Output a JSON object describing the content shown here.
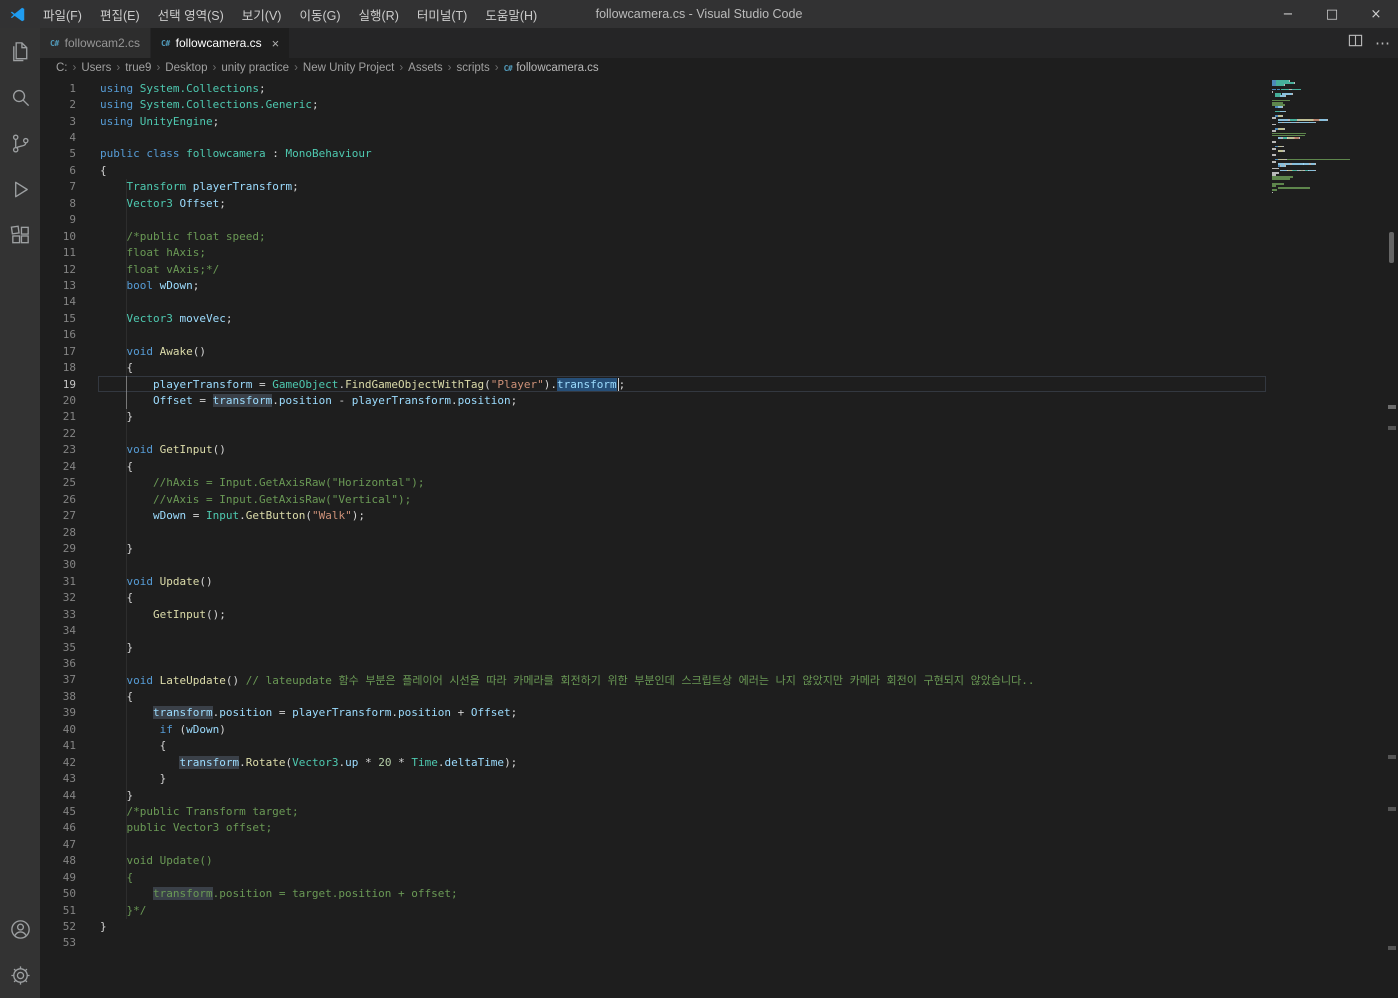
{
  "window": {
    "title": "followcamera.cs - Visual Studio Code",
    "controls": {
      "minimize": "−",
      "maximize": "□",
      "close": "×"
    }
  },
  "menubar": {
    "items": [
      "파일(F)",
      "편집(E)",
      "선택 영역(S)",
      "보기(V)",
      "이동(G)",
      "실행(R)",
      "터미널(T)",
      "도움말(H)"
    ]
  },
  "activity_bar": {
    "top_icons": [
      "explorer",
      "search",
      "source-control",
      "run-debug",
      "extensions"
    ],
    "bottom_icons": [
      "account",
      "settings"
    ]
  },
  "tab_bar": {
    "tabs": [
      {
        "label": "followcam2.cs",
        "icon": "C#",
        "active": false
      },
      {
        "label": "followcamera.cs",
        "icon": "C#",
        "active": true,
        "close": "×"
      }
    ],
    "more_glyph": "⋯"
  },
  "breadcrumb": {
    "separator": "›",
    "segments": [
      "C:",
      "Users",
      "true9",
      "Desktop",
      "unity practice",
      "New Unity Project",
      "Assets",
      "scripts"
    ],
    "file_icon": "C#",
    "file": "followcamera.cs"
  },
  "colors": {
    "accent_blue": "#007acc",
    "titlebar_bg": "#323233",
    "activitybar_bg": "#333333",
    "editor_bg": "#1e1e1e",
    "tab_inactive_bg": "#2d2d2d",
    "tab_active_bg": "#1e1e1e",
    "selection_bg": "#264f78",
    "word_highlight_bg": "#3a4048",
    "csharp_icon": "#519aba",
    "token": {
      "kw": "#569cd6",
      "ty": "#4ec9b0",
      "m": "#dcdcaa",
      "v": "#9cdcfe",
      "st": "#ce9178",
      "cm": "#6a9955",
      "nm": "#b5cea8",
      "pl": "#d4d4d4"
    }
  },
  "editor": {
    "language": "csharp",
    "current_line": 19,
    "lines": [
      {
        "n": 1,
        "t": [
          [
            "kw",
            "using"
          ],
          [
            "pl",
            " "
          ],
          [
            "ty",
            "System.Collections"
          ],
          [
            "pl",
            ";"
          ]
        ]
      },
      {
        "n": 2,
        "t": [
          [
            "kw",
            "using"
          ],
          [
            "pl",
            " "
          ],
          [
            "ty",
            "System.Collections.Generic"
          ],
          [
            "pl",
            ";"
          ]
        ]
      },
      {
        "n": 3,
        "t": [
          [
            "kw",
            "using"
          ],
          [
            "pl",
            " "
          ],
          [
            "ty",
            "UnityEngine"
          ],
          [
            "pl",
            ";"
          ]
        ]
      },
      {
        "n": 4,
        "t": []
      },
      {
        "n": 5,
        "t": [
          [
            "kw",
            "public"
          ],
          [
            "pl",
            " "
          ],
          [
            "kw",
            "class"
          ],
          [
            "pl",
            " "
          ],
          [
            "ty",
            "followcamera"
          ],
          [
            "pl",
            " : "
          ],
          [
            "ty",
            "MonoBehaviour"
          ]
        ]
      },
      {
        "n": 6,
        "t": [
          [
            "pl",
            "{"
          ]
        ]
      },
      {
        "n": 7,
        "t": [
          [
            "pl",
            "    "
          ],
          [
            "ty",
            "Transform"
          ],
          [
            "pl",
            " "
          ],
          [
            "v",
            "playerTransform"
          ],
          [
            "pl",
            ";"
          ]
        ]
      },
      {
        "n": 8,
        "t": [
          [
            "pl",
            "    "
          ],
          [
            "ty",
            "Vector3"
          ],
          [
            "pl",
            " "
          ],
          [
            "v",
            "Offset"
          ],
          [
            "pl",
            ";"
          ]
        ]
      },
      {
        "n": 9,
        "t": []
      },
      {
        "n": 10,
        "t": [
          [
            "cm",
            "    /*public float speed;"
          ]
        ]
      },
      {
        "n": 11,
        "t": [
          [
            "cm",
            "    float hAxis;"
          ]
        ]
      },
      {
        "n": 12,
        "t": [
          [
            "cm",
            "    float vAxis;*/"
          ]
        ]
      },
      {
        "n": 13,
        "t": [
          [
            "pl",
            "    "
          ],
          [
            "kw",
            "bool"
          ],
          [
            "pl",
            " "
          ],
          [
            "v",
            "wDown"
          ],
          [
            "pl",
            ";"
          ]
        ]
      },
      {
        "n": 14,
        "t": []
      },
      {
        "n": 15,
        "t": [
          [
            "pl",
            "    "
          ],
          [
            "ty",
            "Vector3"
          ],
          [
            "pl",
            " "
          ],
          [
            "v",
            "moveVec"
          ],
          [
            "pl",
            ";"
          ]
        ]
      },
      {
        "n": 16,
        "t": []
      },
      {
        "n": 17,
        "t": [
          [
            "pl",
            "    "
          ],
          [
            "kw",
            "void"
          ],
          [
            "pl",
            " "
          ],
          [
            "m",
            "Awake"
          ],
          [
            "pl",
            "()"
          ]
        ]
      },
      {
        "n": 18,
        "t": [
          [
            "pl",
            "    {"
          ]
        ]
      },
      {
        "n": 19,
        "t": [
          [
            "pl",
            "        "
          ],
          [
            "v",
            "playerTransform"
          ],
          [
            "pl",
            " = "
          ],
          [
            "ty",
            "GameObject"
          ],
          [
            "pl",
            "."
          ],
          [
            "m",
            "FindGameObjectWithTag"
          ],
          [
            "pl",
            "("
          ],
          [
            "st",
            "\"Player\""
          ],
          [
            "pl",
            ")."
          ],
          [
            "v sel",
            "transform"
          ],
          [
            "cursor",
            ""
          ],
          [
            "pl",
            ";"
          ]
        ]
      },
      {
        "n": 20,
        "t": [
          [
            "pl",
            "        "
          ],
          [
            "v",
            "Offset"
          ],
          [
            "pl",
            " = "
          ],
          [
            "v wh",
            "transform"
          ],
          [
            "pl",
            "."
          ],
          [
            "v",
            "position"
          ],
          [
            "pl",
            " - "
          ],
          [
            "v",
            "playerTransform"
          ],
          [
            "pl",
            "."
          ],
          [
            "v",
            "position"
          ],
          [
            "pl",
            ";"
          ]
        ]
      },
      {
        "n": 21,
        "t": [
          [
            "pl",
            "    }"
          ]
        ]
      },
      {
        "n": 22,
        "t": []
      },
      {
        "n": 23,
        "t": [
          [
            "pl",
            "    "
          ],
          [
            "kw",
            "void"
          ],
          [
            "pl",
            " "
          ],
          [
            "m",
            "GetInput"
          ],
          [
            "pl",
            "()"
          ]
        ]
      },
      {
        "n": 24,
        "t": [
          [
            "pl",
            "    {"
          ]
        ]
      },
      {
        "n": 25,
        "t": [
          [
            "cm",
            "        //hAxis = Input.GetAxisRaw(\"Horizontal\");"
          ]
        ]
      },
      {
        "n": 26,
        "t": [
          [
            "cm",
            "        //vAxis = Input.GetAxisRaw(\"Vertical\");"
          ]
        ]
      },
      {
        "n": 27,
        "t": [
          [
            "pl",
            "        "
          ],
          [
            "v",
            "wDown"
          ],
          [
            "pl",
            " = "
          ],
          [
            "ty",
            "Input"
          ],
          [
            "pl",
            "."
          ],
          [
            "m",
            "GetButton"
          ],
          [
            "pl",
            "("
          ],
          [
            "st",
            "\"Walk\""
          ],
          [
            "pl",
            ");"
          ]
        ]
      },
      {
        "n": 28,
        "t": []
      },
      {
        "n": 29,
        "t": [
          [
            "pl",
            "    }"
          ]
        ]
      },
      {
        "n": 30,
        "t": []
      },
      {
        "n": 31,
        "t": [
          [
            "pl",
            "    "
          ],
          [
            "kw",
            "void"
          ],
          [
            "pl",
            " "
          ],
          [
            "m",
            "Update"
          ],
          [
            "pl",
            "()"
          ]
        ]
      },
      {
        "n": 32,
        "t": [
          [
            "pl",
            "    {"
          ]
        ]
      },
      {
        "n": 33,
        "t": [
          [
            "pl",
            "        "
          ],
          [
            "m",
            "GetInput"
          ],
          [
            "pl",
            "();"
          ]
        ]
      },
      {
        "n": 34,
        "t": []
      },
      {
        "n": 35,
        "t": [
          [
            "pl",
            "    }"
          ]
        ]
      },
      {
        "n": 36,
        "t": []
      },
      {
        "n": 37,
        "t": [
          [
            "pl",
            "    "
          ],
          [
            "kw",
            "void"
          ],
          [
            "pl",
            " "
          ],
          [
            "m",
            "LateUpdate"
          ],
          [
            "pl",
            "() "
          ],
          [
            "cm",
            "// lateupdate 함수 부분은 플레이어 시선을 따라 카메라를 회전하기 위한 부분인데 스크립트상 에러는 나지 않았지만 카메라 회전이 구현되지 않았습니다.."
          ]
        ]
      },
      {
        "n": 38,
        "t": [
          [
            "pl",
            "    {"
          ]
        ]
      },
      {
        "n": 39,
        "t": [
          [
            "pl",
            "        "
          ],
          [
            "v wh",
            "transform"
          ],
          [
            "pl",
            "."
          ],
          [
            "v",
            "position"
          ],
          [
            "pl",
            " = "
          ],
          [
            "v",
            "playerTransform"
          ],
          [
            "pl",
            "."
          ],
          [
            "v",
            "position"
          ],
          [
            "pl",
            " + "
          ],
          [
            "v",
            "Offset"
          ],
          [
            "pl",
            ";"
          ]
        ]
      },
      {
        "n": 40,
        "t": [
          [
            "pl",
            "         "
          ],
          [
            "kw",
            "if"
          ],
          [
            "pl",
            " ("
          ],
          [
            "v",
            "wDown"
          ],
          [
            "pl",
            ")"
          ]
        ]
      },
      {
        "n": 41,
        "t": [
          [
            "pl",
            "         {"
          ]
        ]
      },
      {
        "n": 42,
        "t": [
          [
            "pl",
            "            "
          ],
          [
            "v wh",
            "transform"
          ],
          [
            "pl",
            "."
          ],
          [
            "m",
            "Rotate"
          ],
          [
            "pl",
            "("
          ],
          [
            "ty",
            "Vector3"
          ],
          [
            "pl",
            "."
          ],
          [
            "v",
            "up"
          ],
          [
            "pl",
            " * "
          ],
          [
            "nm",
            "20"
          ],
          [
            "pl",
            " * "
          ],
          [
            "ty",
            "Time"
          ],
          [
            "pl",
            "."
          ],
          [
            "v",
            "deltaTime"
          ],
          [
            "pl",
            ");"
          ]
        ]
      },
      {
        "n": 43,
        "t": [
          [
            "pl",
            "         }"
          ]
        ]
      },
      {
        "n": 44,
        "t": [
          [
            "pl",
            "    }"
          ]
        ]
      },
      {
        "n": 45,
        "t": [
          [
            "cm",
            "    /*public Transform target;"
          ]
        ]
      },
      {
        "n": 46,
        "t": [
          [
            "cm",
            "    public Vector3 offset;"
          ]
        ]
      },
      {
        "n": 47,
        "t": []
      },
      {
        "n": 48,
        "t": [
          [
            "cm",
            "    void Update()"
          ]
        ]
      },
      {
        "n": 49,
        "t": [
          [
            "cm",
            "    {"
          ]
        ]
      },
      {
        "n": 50,
        "t": [
          [
            "cm",
            "        "
          ],
          [
            "cm wh",
            "transform"
          ],
          [
            "cm",
            ".position = target.position + offset;"
          ]
        ]
      },
      {
        "n": 51,
        "t": [
          [
            "cm",
            "    }*/"
          ]
        ]
      },
      {
        "n": 52,
        "t": [
          [
            "pl",
            "}"
          ]
        ]
      },
      {
        "n": 53,
        "t": []
      }
    ]
  }
}
